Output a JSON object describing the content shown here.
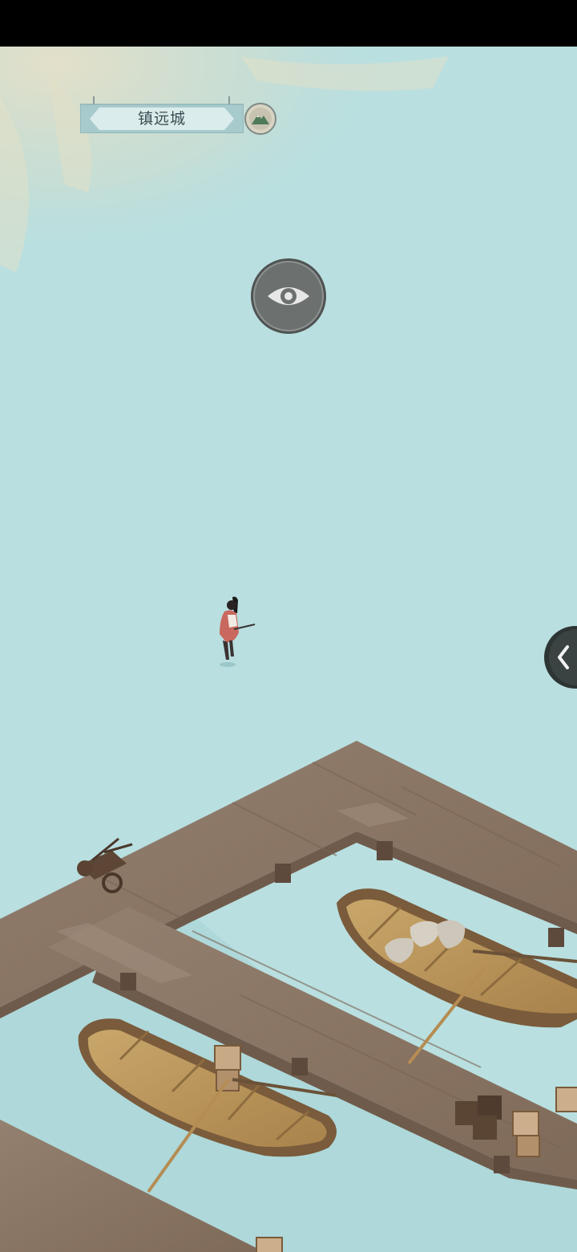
{
  "hud": {
    "location_name": "镇远城",
    "map_button_icon": "mountain-map-icon",
    "view_button_icon": "eye-icon",
    "side_toggle_icon": "chevron-left-icon"
  },
  "colors": {
    "water": "#b9dfe0",
    "dock_wood": "#8b7564",
    "boat_wood": "#b08c52",
    "banner": "#a9cdd0",
    "character_robe": "#c8685e"
  }
}
